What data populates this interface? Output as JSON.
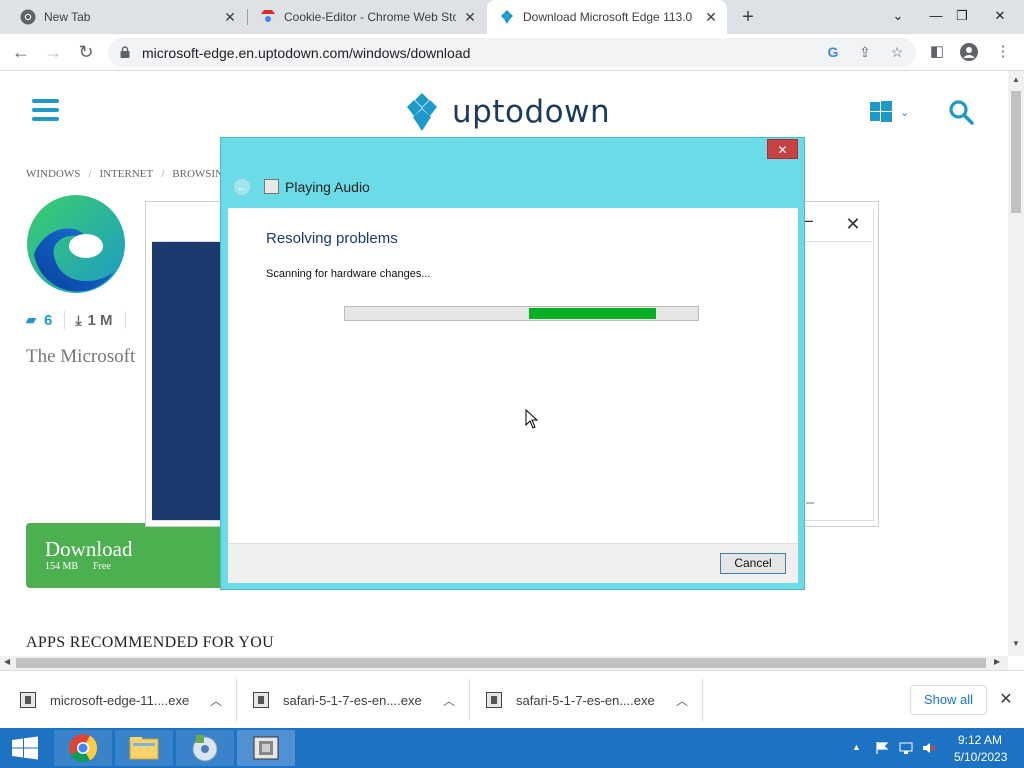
{
  "tabs": [
    {
      "title": "New Tab",
      "icon": "chrome-icon"
    },
    {
      "title": "Cookie-Editor - Chrome Web Sto",
      "icon": "webstore-icon"
    },
    {
      "title": "Download Microsoft Edge 113.0",
      "icon": "uptodown-icon",
      "active": true
    }
  ],
  "toolbar": {
    "url": "microsoft-edge.en.uptodown.com/windows/download"
  },
  "site": {
    "logo_text": "uptodown",
    "breadcrumb": [
      "WINDOWS",
      "INTERNET",
      "BROWSING"
    ],
    "comments_count": "6",
    "downloads_count": "1 M",
    "description": "The Microsoft",
    "download_label": "Download",
    "download_size": "154 MB",
    "download_free": "Free",
    "recommended_heading": "APPS RECOMMENDED FOR YOU",
    "brand_color": "#1d9ac8"
  },
  "dialog": {
    "title": "Playing Audio",
    "close_label": "✕",
    "heading": "Resolving problems",
    "status": "Scanning for hardware changes...",
    "progress": {
      "start": 0.52,
      "end": 0.88
    },
    "cancel_label": "Cancel"
  },
  "downloads": {
    "items": [
      "microsoft-edge-11....exe",
      "safari-5-1-7-es-en....exe",
      "safari-5-1-7-es-en....exe"
    ],
    "show_all_label": "Show all"
  },
  "taskbar": {
    "time": "9:12 AM",
    "date": "5/10/2023"
  }
}
